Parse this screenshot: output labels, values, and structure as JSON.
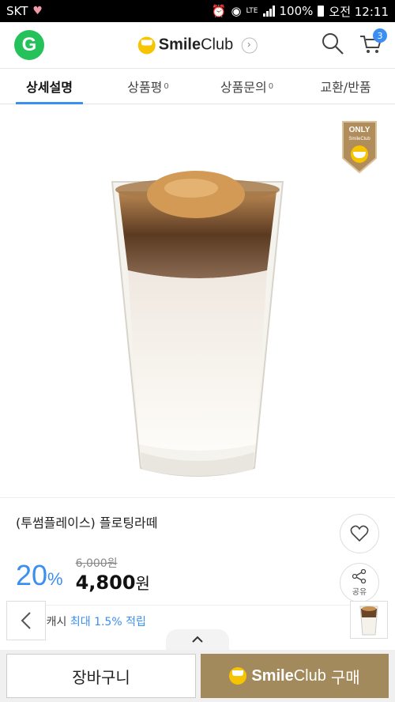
{
  "status": {
    "carrier": "SKT",
    "network": "LTE",
    "battery": "100%",
    "time": "오전 12:11"
  },
  "header": {
    "logo_letter": "G",
    "brand_bold": "Smile",
    "brand_rest": "Club",
    "cart_count": "3"
  },
  "tabs": [
    {
      "label": "상세설명",
      "count": ""
    },
    {
      "label": "상품평",
      "count": "0"
    },
    {
      "label": "상품문의",
      "count": "0"
    },
    {
      "label": "교환/반품",
      "count": ""
    }
  ],
  "badge": {
    "top": "ONLY",
    "sub": "SmileClub"
  },
  "product": {
    "title": "(투썸플레이스) 플로팅라떼",
    "discount_num": "20",
    "discount_unit": "%",
    "original_price": "6,000원",
    "price_num": "4,800",
    "price_unit": "원",
    "share_label": "공유",
    "cash_label": "스마일캐시",
    "cash_value": "최대 1.5% 적립"
  },
  "bottom": {
    "cart_label": "장바구니",
    "buy_brand_bold": "Smile",
    "buy_brand_rest": "Club",
    "buy_label": "구매"
  },
  "colors": {
    "accent": "#3b8ff0",
    "brand_green": "#25c15a",
    "smile_yellow": "#f6c400",
    "buy_gold": "#a38a5c"
  }
}
